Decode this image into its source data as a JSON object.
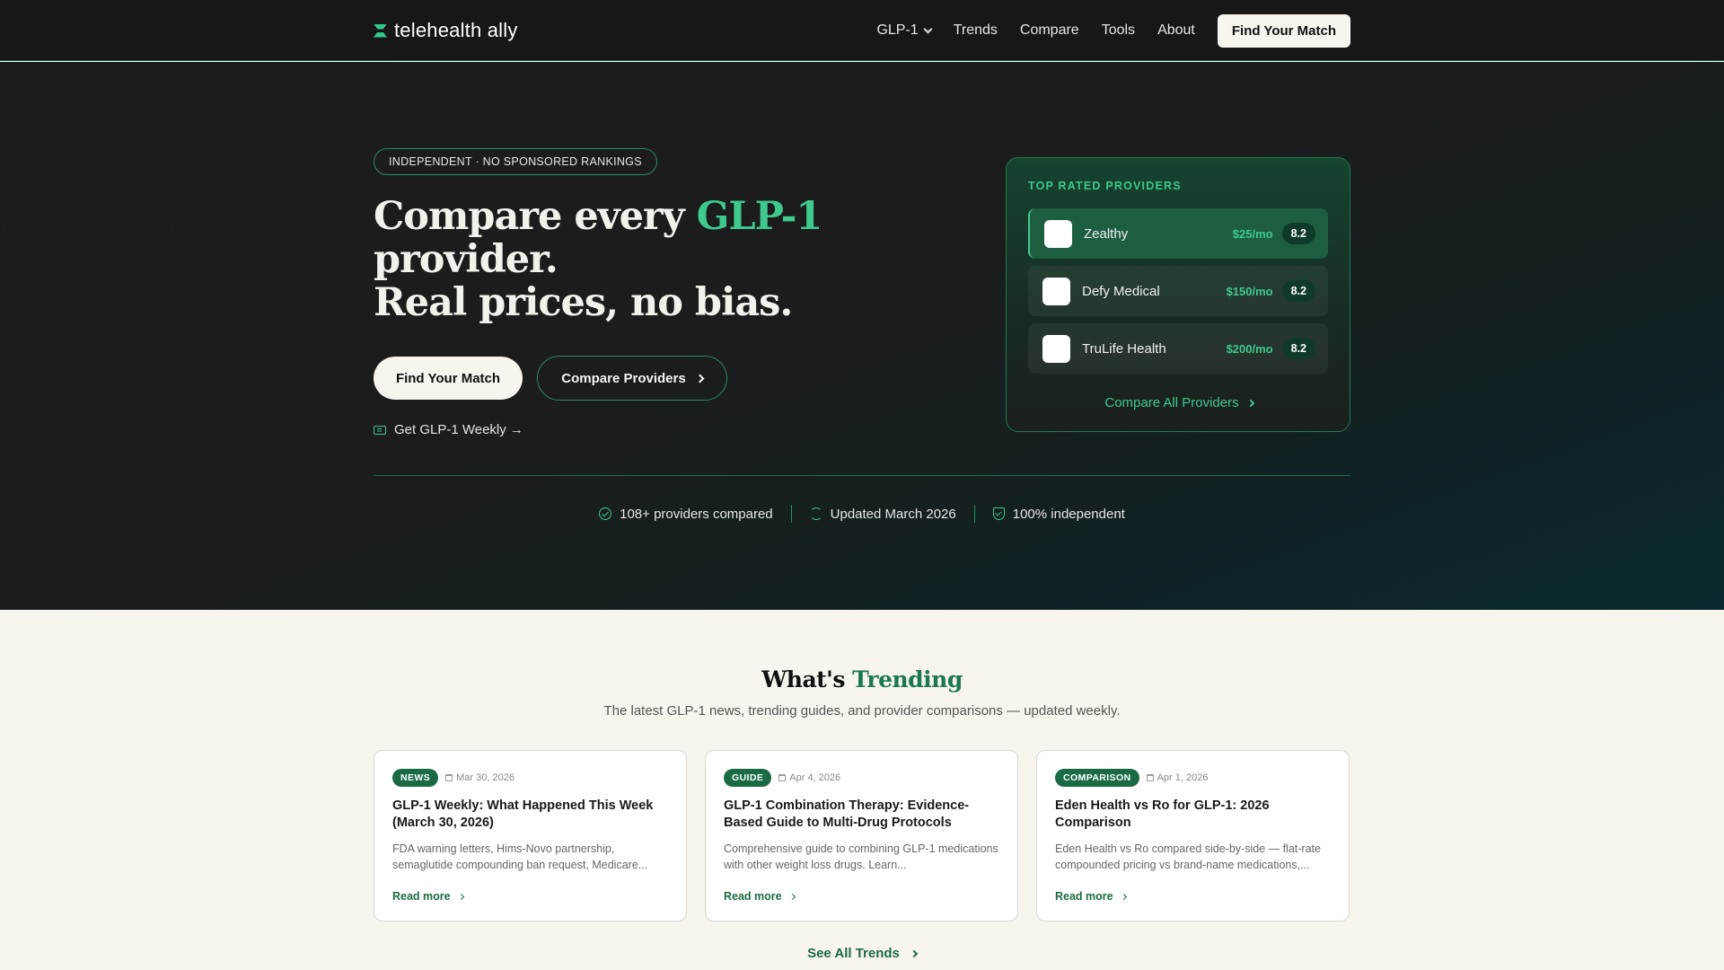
{
  "nav": {
    "brand": "telehealth ally",
    "links": [
      "GLP-1",
      "Trends",
      "Compare",
      "Tools",
      "About"
    ],
    "cta": "Find Your Match"
  },
  "hero": {
    "badge": "INDEPENDENT · NO SPONSORED RANKINGS",
    "title_part1": "Compare every ",
    "title_accent": "GLP-1",
    "title_part2": "provider.",
    "title_line3": "Real prices, no bias.",
    "primary_button": "Find Your Match",
    "secondary_button": "Compare Providers",
    "weekly_link": "Get GLP-1 Weekly →",
    "stats": [
      "108+ providers compared",
      "Updated March 2026",
      "100% independent"
    ]
  },
  "providers_card": {
    "label": "TOP RATED PROVIDERS",
    "providers": [
      {
        "name": "Zealthy",
        "price": "$25/mo",
        "score": "8.2"
      },
      {
        "name": "Defy Medical",
        "price": "$150/mo",
        "score": "8.2"
      },
      {
        "name": "TruLife Health",
        "price": "$200/mo",
        "score": "8.2"
      }
    ],
    "link": "Compare All Providers"
  },
  "trending": {
    "title_part1": "What's ",
    "title_accent": "Trending",
    "subtitle": "The latest GLP-1 news, trending guides, and provider comparisons — updated weekly.",
    "cards": [
      {
        "tag": "NEWS",
        "date": "Mar 30, 2026",
        "title": "GLP-1 Weekly: What Happened This Week (March 30, 2026)",
        "desc": "FDA warning letters, Hims-Novo partnership, semaglutide compounding ban request, Medicare...",
        "read_more": "Read more"
      },
      {
        "tag": "GUIDE",
        "date": "Apr 4, 2026",
        "title": "GLP-1 Combination Therapy: Evidence-Based Guide to Multi-Drug Protocols",
        "desc": "Comprehensive guide to combining GLP-1 medications with other weight loss drugs. Learn...",
        "read_more": "Read more"
      },
      {
        "tag": "COMPARISON",
        "date": "Apr 1, 2026",
        "title": "Eden Health vs Ro for GLP-1: 2026 Comparison",
        "desc": "Eden Health vs Ro compared side-by-side — flat-rate compounded pricing vs brand-name medications,...",
        "read_more": "Read more"
      }
    ],
    "see_all": "See All Trends"
  },
  "colors": {
    "accent": "#3ec98d",
    "brand_green": "#1a6b45",
    "hero_bg": "#1b1b1b",
    "page_bg": "#f8f4ee"
  }
}
